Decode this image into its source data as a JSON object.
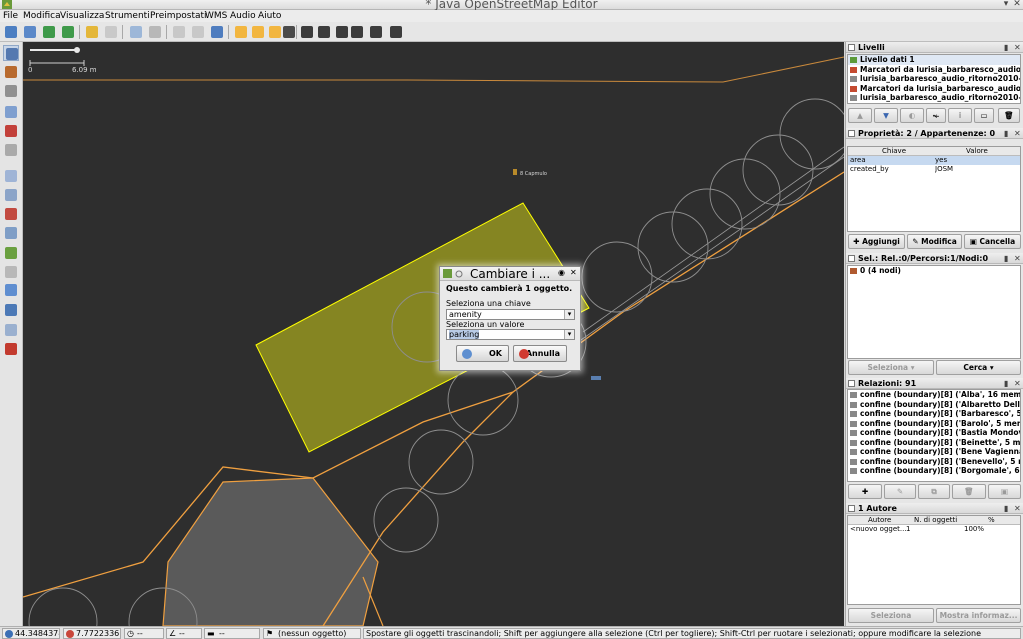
{
  "window": {
    "title": "* Java OpenStreetMap Editor"
  },
  "menu": [
    "File",
    "Modifica",
    "Visualizza",
    "Strumenti",
    "Preimpostati",
    "WMS",
    "Audio",
    "Aiuto"
  ],
  "map": {
    "scale_min": "0",
    "scale_max": "6.09 m",
    "poi_label": "8 Capmulo"
  },
  "layers_panel": {
    "title": "Livelli",
    "items": [
      "Livello dati 1",
      "Marcatori da lurisia_barbaresco_audio_ri",
      "lurisia_barbaresco_audio_ritorno2010-08",
      "Marcatori da lurisia_barbaresco_audio_ri",
      "lurisia_barbaresco_audio_ritorno2010-08"
    ]
  },
  "properties_panel": {
    "title": "Proprietà: 2 / Appartenenze: 0",
    "col_key": "Chiave",
    "col_value": "Valore",
    "rows": [
      {
        "key": "area",
        "value": "yes"
      },
      {
        "key": "created_by",
        "value": "JOSM"
      }
    ],
    "btn_add": "Aggiungi",
    "btn_edit": "Modifica",
    "btn_delete": "Cancella"
  },
  "selection_panel": {
    "title": "Sel.: Rel.:0/Percorsi:1/Nodi:0",
    "items": [
      "0 (4 nodi)"
    ],
    "btn_select": "Seleziona",
    "btn_search": "Cerca"
  },
  "relations_panel": {
    "title": "Relazioni: 91",
    "items": [
      "confine (boundary)[8] ('Alba', 16 membri",
      "confine (boundary)[8] ('Albaretto Della T",
      "confine (boundary)[8] ('Barbaresco', 5 m",
      "confine (boundary)[8] ('Barolo', 5 membr",
      "confine (boundary)[8] ('Bastia Mondovi',",
      "confine (boundary)[8] ('Beinette', 5 mem",
      "confine (boundary)[8] ('Bene Vagienna',",
      "confine (boundary)[8] ('Benevello', 5 me",
      "confine (boundary)[8] ('Borgomale', 6 me"
    ]
  },
  "authors_panel": {
    "title": "1 Autore",
    "col_author": "Autore",
    "col_count": "N. di oggetti",
    "col_pct": "%",
    "rows": [
      {
        "author": "<nuovo ogget...",
        "count": "1",
        "pct": "100%"
      }
    ],
    "btn_select": "Seleziona",
    "btn_info": "Mostra informaz..."
  },
  "dialog": {
    "title": "Cambiare i ...",
    "message": "Questo cambierà 1 oggetto.",
    "key_label": "Seleziona una chiave",
    "key_value": "amenity",
    "value_label": "Seleziona un valore",
    "value_value": "parking",
    "ok": "OK",
    "cancel": "Annulla"
  },
  "status": {
    "lat": "44.3484378",
    "lon": "7.7722336",
    "heading": "--",
    "angle": "--",
    "distance": "--",
    "object": "(nessun oggetto)",
    "help": "Spostare gli oggetti trascinandoli; Shift per aggiungere alla selezione (Ctrl per togliere); Shift-Ctrl per ruotare i selezionati; oppure modificare la selezione"
  },
  "colors": {
    "map_bg": "#2e2e2e",
    "selected_area": "#a3a31f",
    "way_orange": "#f0a040",
    "area_gray": "#5a5a5a",
    "selection_yellow": "#ffff00"
  }
}
